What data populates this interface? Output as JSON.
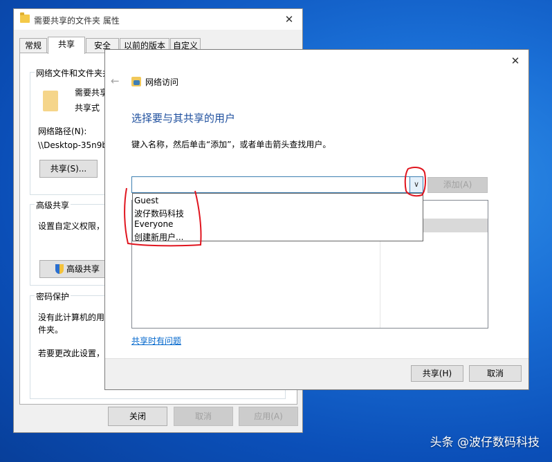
{
  "props_window": {
    "title": "需要共享的文件夹 属性",
    "close_glyph": "✕",
    "tabs": [
      "常规",
      "共享",
      "安全",
      "以前的版本",
      "自定义"
    ],
    "network_group": {
      "label": "网络文件和文件夹共",
      "folder_name": "需要共享",
      "status": "共享式",
      "path_label": "网络路径(N):",
      "path_value": "\\\\Desktop-35n9b",
      "share_button": "共享(S)..."
    },
    "advanced_group": {
      "label": "高级共享",
      "text": "设置自定义权限，",
      "button": "高级共享"
    },
    "password_group": {
      "label": "密码保护",
      "text_line1": "没有此计算机的用",
      "text_line2": "件夹。",
      "text_line3": "若要更改此设置，"
    },
    "buttons": {
      "close": "关闭",
      "cancel": "取消",
      "apply": "应用(A)"
    }
  },
  "share_dialog": {
    "close_glyph": "✕",
    "back_glyph": "←",
    "title": "网络访问",
    "heading": "选择要与其共享的用户",
    "instruction": "键入名称，然后单击“添加”，或者单击箭头查找用户。",
    "combo": {
      "value": "",
      "arrow": "∨"
    },
    "add_button": "添加(A)",
    "dropdown_items": [
      "Guest",
      "波仔数码科技",
      "Everyone",
      "创建新用户..."
    ],
    "help_link": "共享时有问题",
    "share_button": "共享(H)",
    "cancel_button": "取消"
  },
  "watermark": "头条 @波仔数码科技",
  "colors": {
    "annotation_red": "#e0141e",
    "heading_blue": "#1e4f9e",
    "link_blue": "#0066cc"
  }
}
